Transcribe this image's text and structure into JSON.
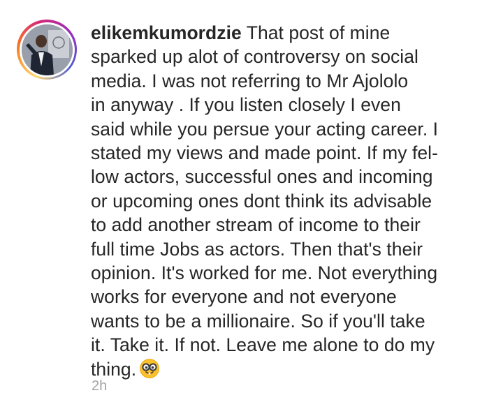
{
  "comment": {
    "username": "elikemkumordzie",
    "lines": [
      "That post of mine",
      "sparked up alot of controversy on social",
      "media. I was not referring to Mr Ajololo",
      "in anyway . If you listen closely I even",
      "said while you persue your acting career. I",
      "stated my views and made point. If my fel-",
      "low actors, successful ones and incoming",
      "or upcoming ones dont think its advisable",
      "to add another stream of income to their",
      "full time Jobs as actors. Then that's their",
      "opinion. It's worked for me. Not everything",
      "works for everyone and not everyone",
      "wants to be a millionaire. So if you'll take",
      "it. Take it. If not. Leave me alone to do my",
      "thing."
    ],
    "emoji_icon": "nerd-face-emoji-icon",
    "timestamp": "2h"
  },
  "colors": {
    "text": "#262626",
    "timestamp": "#a3a3a3",
    "story_ring_start": "#feda75",
    "story_ring_end": "#d62976"
  }
}
